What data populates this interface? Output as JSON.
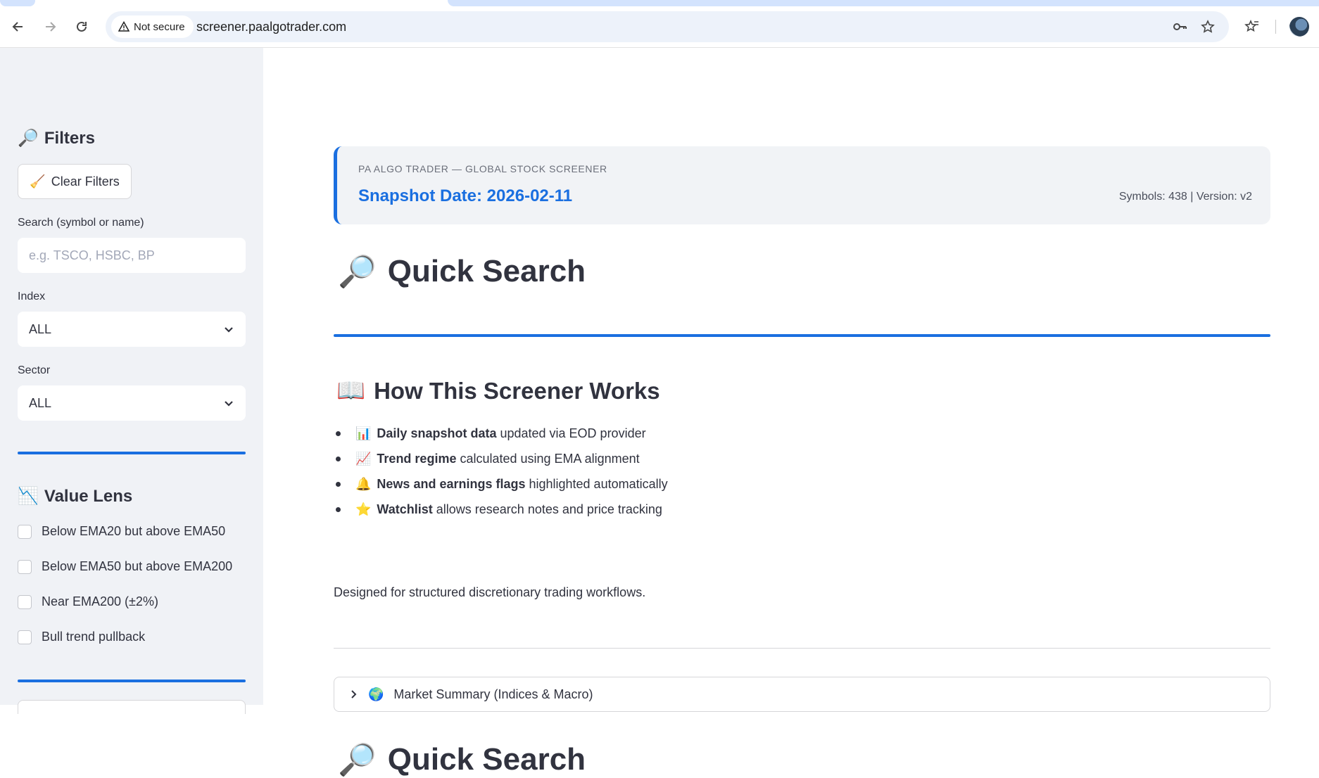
{
  "browser": {
    "security_label": "Not secure",
    "url": "screener.paalgotrader.com"
  },
  "sidebar": {
    "filters_title": "Filters",
    "clear_filters_label": "Clear Filters",
    "search": {
      "label": "Search (symbol or name)",
      "placeholder": "e.g. TSCO, HSBC, BP"
    },
    "index": {
      "label": "Index",
      "value": "ALL"
    },
    "sector": {
      "label": "Sector",
      "value": "ALL"
    },
    "value_lens": {
      "title": "Value Lens",
      "options": [
        {
          "label": "Below EMA20 but above EMA50",
          "checked": false
        },
        {
          "label": "Below EMA50 but above EMA200",
          "checked": false
        },
        {
          "label": "Near EMA200 (±2%)",
          "checked": false
        },
        {
          "label": "Bull trend pullback",
          "checked": false
        }
      ]
    }
  },
  "main": {
    "banner": {
      "eyebrow": "PA ALGO TRADER — GLOBAL STOCK SCREENER",
      "snapshot": "Snapshot Date: 2026-02-11",
      "meta": "Symbols: 438 | Version: v2"
    },
    "quick_search_title": "Quick Search",
    "how_title": "How This Screener Works",
    "bullets": [
      {
        "emoji": "📊",
        "bold": "Daily snapshot data",
        "rest": "updated via EOD provider"
      },
      {
        "emoji": "📈",
        "bold": "Trend regime",
        "rest": "calculated using EMA alignment"
      },
      {
        "emoji": "🔔",
        "bold": "News and earnings flags",
        "rest": "highlighted automatically"
      },
      {
        "emoji": "⭐",
        "bold": "Watchlist",
        "rest": "allows research notes and price tracking"
      }
    ],
    "paragraph": "Designed for structured discretionary trading workflows.",
    "expander_label": "Market Summary (Indices & Macro)",
    "quick_search_title_2": "Quick Search"
  },
  "colors": {
    "accent": "#1a6fe0",
    "sidebar_bg": "#f0f2f6",
    "banner_bg": "#f1f3f6"
  }
}
